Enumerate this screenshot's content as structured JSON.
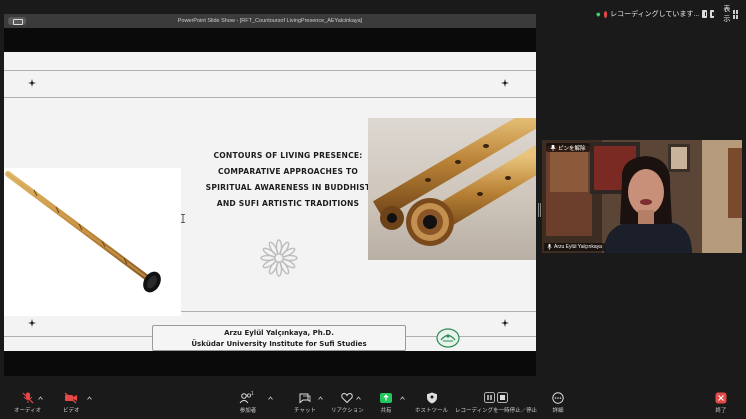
{
  "recording": {
    "label": "レコーディングしています...",
    "view_label": "表示"
  },
  "window": {
    "title": "PowerPoint Slide Show - [RFT_Countoursof LivingPresence_AEYalcinkaya]"
  },
  "slide": {
    "title_lines": [
      "CONTOURS OF LIVING PRESENCE:",
      "COMPARATIVE APPROACHES TO",
      "SPIRITUAL AWARENESS IN BUDDHIST",
      "AND SUFI ARTISTIC TRADITIONS"
    ],
    "author": "Arzu Eylül Yalçınkaya, Ph.D.",
    "institution": "Üsküdar University Institute for Sufi Studies"
  },
  "video": {
    "pin_label": "ピンを解除",
    "participant_name": "Arzu Eylül Yalçınkaya"
  },
  "toolbar": {
    "audio": "オーディオ",
    "video": "ビデオ",
    "participants": "参加者",
    "participants_count": "1",
    "chat": "チャット",
    "reactions": "リアクション",
    "share": "共有",
    "host_tools": "ホストツール",
    "record": "レコーディングを一時停止／停止",
    "details": "詳細",
    "end": "終了"
  },
  "colors": {
    "share_active": "#22c55e",
    "end_red": "#e54848",
    "mute_red": "#e54848"
  }
}
